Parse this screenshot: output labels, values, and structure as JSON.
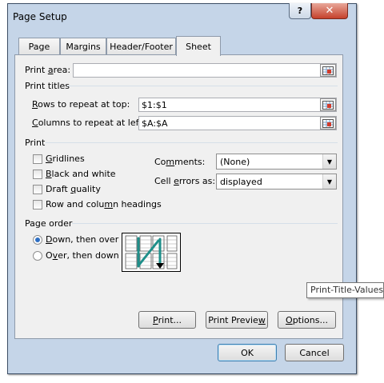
{
  "window": {
    "title": "Page Setup",
    "help_label": "?",
    "close_label": "✕"
  },
  "tabs": [
    {
      "label": "Page",
      "active": false
    },
    {
      "label": "Margins",
      "active": false
    },
    {
      "label": "Header/Footer",
      "active": false
    },
    {
      "label": "Sheet",
      "active": true
    }
  ],
  "print_area": {
    "label_pre": "Print ",
    "label_key": "a",
    "label_post": "rea:",
    "value": ""
  },
  "print_titles": {
    "section_label": "Print titles",
    "rows": {
      "label_key": "R",
      "label_post": "ows to repeat at top:",
      "value": "$1:$1"
    },
    "columns": {
      "label_key": "C",
      "label_post": "olumns to repeat at left:",
      "value": "$A:$A"
    }
  },
  "print_section": {
    "label": "Print",
    "checkboxes": [
      {
        "key": "G",
        "rest": "ridlines",
        "checked": false
      },
      {
        "key": "B",
        "rest": "lack and white",
        "checked": false
      },
      {
        "pre": "Draft ",
        "key": "q",
        "rest": "uality",
        "checked": false
      },
      {
        "pre": "Row and colu",
        "key": "m",
        "rest": "n headings",
        "checked": false
      }
    ],
    "comments": {
      "label_pre": "Co",
      "label_key": "m",
      "label_post": "ments:",
      "value": "(None)"
    },
    "cell_errors": {
      "label_pre": "Cell ",
      "label_key": "e",
      "label_post": "rrors as:",
      "value": "displayed"
    }
  },
  "page_order": {
    "label": "Page order",
    "options": [
      {
        "key": "D",
        "rest": "own, then over",
        "selected": true
      },
      {
        "pre": "O",
        "key": "v",
        "rest": "er, then down",
        "selected": false
      }
    ]
  },
  "buttons": {
    "print": {
      "key": "P",
      "rest": "rint..."
    },
    "preview": {
      "pre": "Print Previe",
      "key": "w",
      "rest": ""
    },
    "options": {
      "key": "O",
      "rest": "ptions..."
    },
    "ok": "OK",
    "cancel": "Cancel"
  },
  "tooltip": "Print-Title-Values",
  "icons": {
    "range": "collapse-range-icon",
    "dropdown": "chevron-down-icon",
    "order": "page-order-preview-icon"
  },
  "colors": {
    "accent": "#2e6fc3",
    "frame": "#c5d5e8",
    "close": "#c5412b",
    "arrow": "#1e8f8a"
  }
}
